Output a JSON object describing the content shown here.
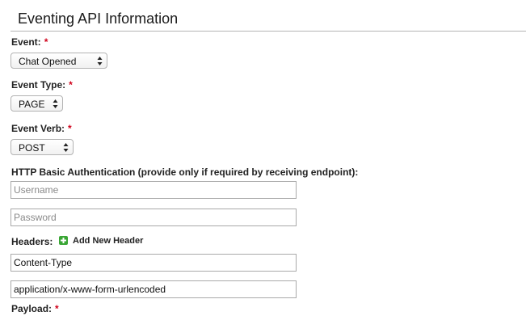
{
  "section": {
    "title": "Eventing API Information"
  },
  "event": {
    "label": "Event:",
    "required_marker": "*",
    "selected": "Chat Opened"
  },
  "event_type": {
    "label": "Event Type:",
    "required_marker": "*",
    "selected": "PAGE"
  },
  "event_verb": {
    "label": "Event Verb:",
    "required_marker": "*",
    "selected": "POST"
  },
  "auth": {
    "label": "HTTP Basic Authentication (provide only if required by receiving endpoint):",
    "username": {
      "value": "",
      "placeholder": "Username"
    },
    "password": {
      "value": "",
      "placeholder": "Password"
    }
  },
  "headers": {
    "label": "Headers:",
    "add_label": "Add New Header",
    "add_icon": "plus-icon",
    "entries": [
      {
        "value": "Content-Type"
      },
      {
        "value": "application/x-www-form-urlencoded"
      }
    ]
  },
  "payload": {
    "label": "Payload:",
    "required_marker": "*"
  },
  "colors": {
    "required": "#d0021b",
    "add_icon_green": "#3aa635"
  }
}
